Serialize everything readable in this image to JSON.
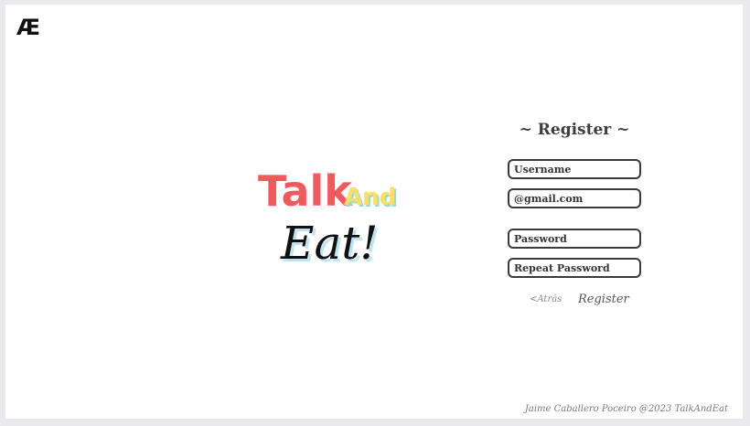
{
  "header": {
    "logo_text": "Æ"
  },
  "brand": {
    "word_talk": "Talk",
    "word_and": "And",
    "word_eat": "Eat!",
    "colors": {
      "talk": "#f05a5e",
      "and": "#f7df6a",
      "and_shadow": "#9fd8d0",
      "eat": "#111111",
      "eat_shadow": "#bfe3f2"
    }
  },
  "register": {
    "title": "~ Register ~",
    "username_placeholder": "Username",
    "email_placeholder": "@gmail.com",
    "password_placeholder": "Password",
    "repeat_password_placeholder": "Repeat Password",
    "back_label": "<Atrás",
    "submit_label": "Register"
  },
  "footer": {
    "text": "Jaime Caballero Poceiro @2023 TalkAndEat"
  }
}
